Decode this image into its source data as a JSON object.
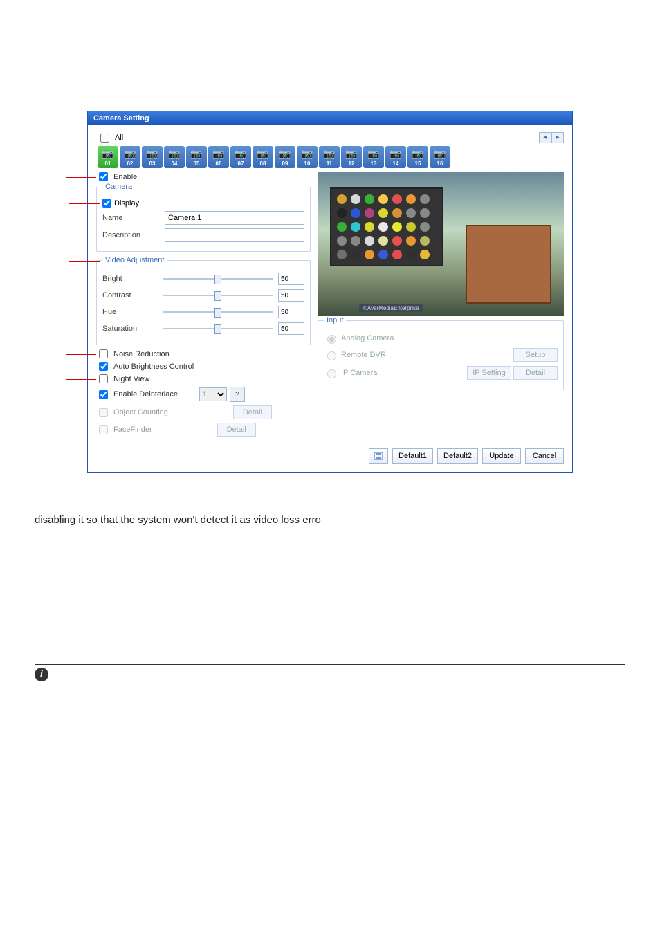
{
  "dialog": {
    "title": "Camera Setting",
    "all_label": "All",
    "enable_label": "Enable",
    "camera_tabs": [
      "01",
      "02",
      "03",
      "04",
      "05",
      "06",
      "07",
      "08",
      "09",
      "10",
      "11",
      "12",
      "13",
      "14",
      "15",
      "16"
    ],
    "selected_tab_index": 0
  },
  "camera_group": {
    "legend": "Camera",
    "display_label": "Display",
    "name_label": "Name",
    "name_value": "Camera 1",
    "description_label": "Description",
    "description_value": ""
  },
  "video_adjustment": {
    "legend": "Video Adjustment",
    "bright": {
      "label": "Bright",
      "value": "50"
    },
    "contrast": {
      "label": "Contrast",
      "value": "50"
    },
    "hue": {
      "label": "Hue",
      "value": "50"
    },
    "saturation": {
      "label": "Saturation",
      "value": "50"
    }
  },
  "options": {
    "noise_reduction": "Noise Reduction",
    "auto_brightness": "Auto Brightness Control",
    "night_view": "Night View",
    "enable_deinterlace": "Enable Deinterlace",
    "deinterlace_value": "1",
    "object_counting": "Object Counting",
    "facefinder": "FaceFinder",
    "detail_label": "Detail"
  },
  "preview": {
    "watermark": "©AverMediaEnterprise"
  },
  "input_group": {
    "legend": "Input",
    "analog": "Analog Camera",
    "remote": "Remote DVR",
    "ipcam": "IP Camera",
    "setup": "Setup",
    "ip_setting": "IP Setting",
    "detail": "Detail"
  },
  "footer": {
    "default1": "Default1",
    "default2": "Default2",
    "update": "Update",
    "cancel": "Cancel"
  },
  "page_text": {
    "caption": "disabling it so that the system won't detect it as video loss erro"
  }
}
